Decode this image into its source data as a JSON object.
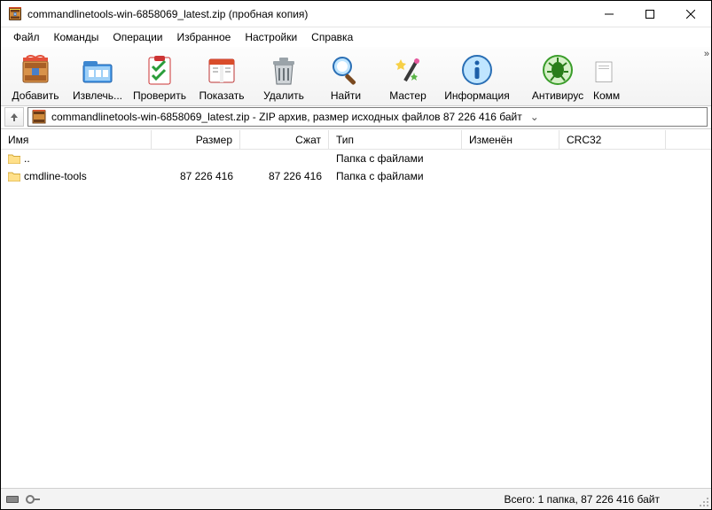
{
  "title": "commandlinetools-win-6858069_latest.zip (пробная копия)",
  "menu": {
    "file": "Файл",
    "commands": "Команды",
    "operations": "Операции",
    "favorites": "Избранное",
    "settings": "Настройки",
    "help": "Справка"
  },
  "toolbar": {
    "add": "Добавить",
    "extract": "Извлечь...",
    "test": "Проверить",
    "view": "Показать",
    "delete": "Удалить",
    "find": "Найти",
    "wizard": "Мастер",
    "info": "Информация",
    "antivirus": "Антивирус",
    "comment": "Комм"
  },
  "address": "commandlinetools-win-6858069_latest.zip - ZIP архив, размер исходных файлов 87 226 416 байт",
  "columns": {
    "name": "Имя",
    "size": "Размер",
    "packed": "Сжат",
    "type": "Тип",
    "modified": "Изменён",
    "crc": "CRC32"
  },
  "rows": [
    {
      "name": "..",
      "size": "",
      "packed": "",
      "type": "Папка с файлами",
      "modified": "",
      "crc": ""
    },
    {
      "name": "cmdline-tools",
      "size": "87 226 416",
      "packed": "87 226 416",
      "type": "Папка с файлами",
      "modified": "",
      "crc": ""
    }
  ],
  "status": "Всего: 1 папка, 87 226 416 байт"
}
